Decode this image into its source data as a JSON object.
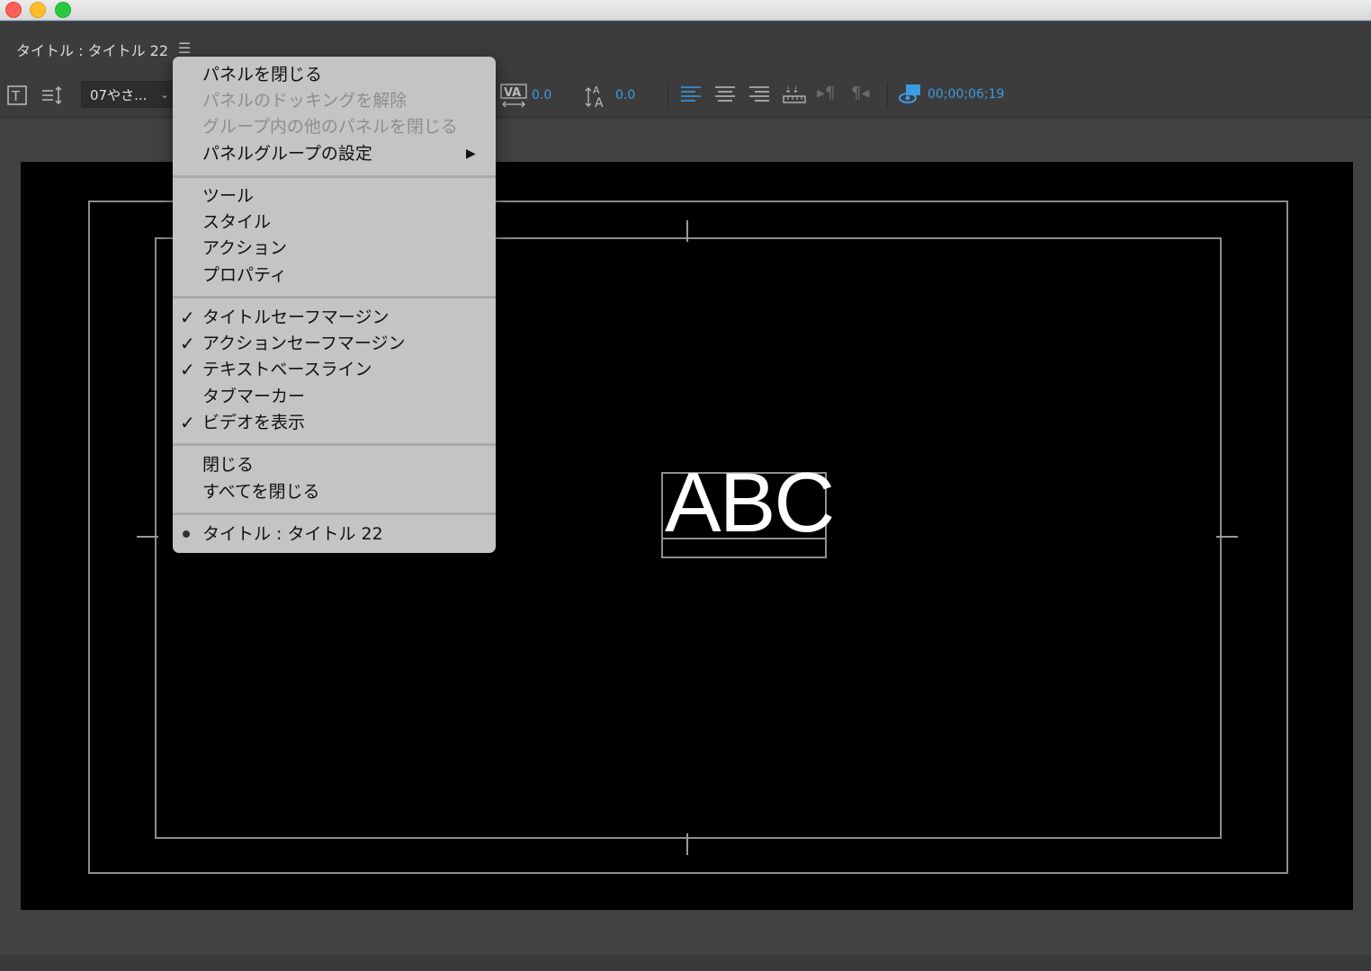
{
  "window": {
    "close": "close",
    "minimize": "minimize",
    "maximize": "maximize"
  },
  "panel": {
    "title": "タイトル : タイトル 22",
    "menu_icon": "hamburger-icon"
  },
  "toolbar": {
    "font_name": "07やさ...",
    "kerning_value": "0.0",
    "leading_value": "0.0",
    "timecode": "00;00;06;19",
    "icons": [
      "type-tool-icon",
      "vertical-type-icon",
      "kerning-icon",
      "leading-icon",
      "align-left-icon",
      "align-center-icon",
      "align-right-icon",
      "tab-stops-icon",
      "paragraph-ltr-icon",
      "paragraph-rtl-icon",
      "show-video-icon"
    ]
  },
  "canvas": {
    "text": "ABC"
  },
  "menu": {
    "group1": [
      {
        "label": "パネルを閉じる",
        "enabled": true
      },
      {
        "label": "パネルのドッキングを解除",
        "enabled": false
      },
      {
        "label": "グループ内の他のパネルを閉じる",
        "enabled": false
      },
      {
        "label": "パネルグループの設定",
        "enabled": true,
        "submenu": "▶"
      }
    ],
    "group2": [
      {
        "label": "ツール"
      },
      {
        "label": "スタイル"
      },
      {
        "label": "アクション"
      },
      {
        "label": "プロパティ"
      }
    ],
    "group3": [
      {
        "label": "タイトルセーフマージン",
        "checked": true
      },
      {
        "label": "アクションセーフマージン",
        "checked": true
      },
      {
        "label": "テキストベースライン",
        "checked": true
      },
      {
        "label": "タブマーカー",
        "checked": false
      },
      {
        "label": "ビデオを表示",
        "checked": true
      }
    ],
    "check_mark": "✓",
    "group4": [
      {
        "label": "閉じる"
      },
      {
        "label": "すべてを閉じる"
      }
    ],
    "group5": [
      {
        "label": "タイトル : タイトル 22",
        "active": true
      }
    ]
  }
}
